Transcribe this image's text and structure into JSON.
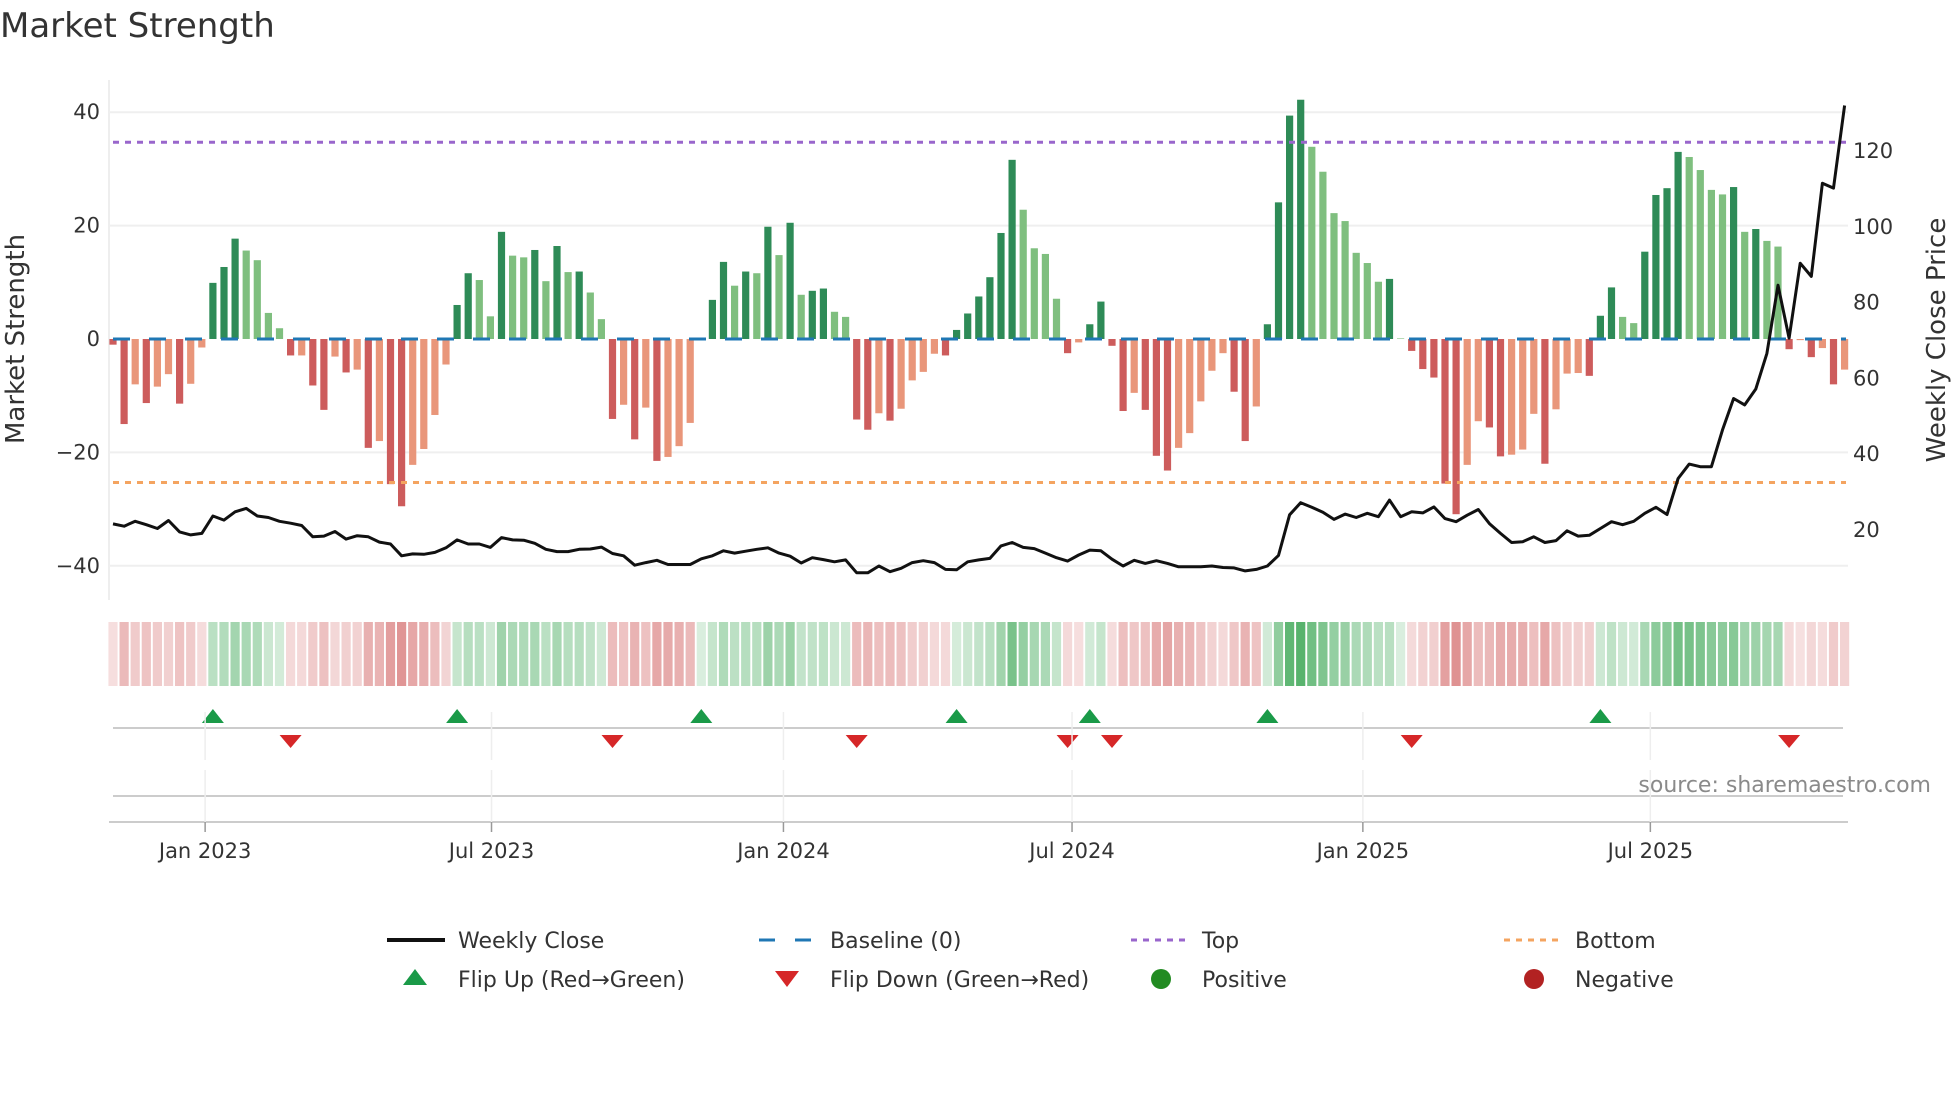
{
  "title": "Market Strength",
  "source": "source: sharemaestro.com",
  "colors": {
    "strong_green": "#2e8b57",
    "weak_green": "#7fbf7f",
    "strong_red": "#cd5c5c",
    "weak_red": "#e9967a",
    "baseline": "#1f77b4",
    "top": "#9966cc",
    "bottom": "#f4a460",
    "flip_up": "#1a9a48",
    "flip_down": "#d62728",
    "positive": "#228b22",
    "negative": "#b22222",
    "close": "#111111"
  },
  "legend": [
    {
      "key": "close",
      "label": "Weekly Close",
      "icon": "solid-line"
    },
    {
      "key": "baseline",
      "label": "Baseline (0)",
      "icon": "dashed-line"
    },
    {
      "key": "top",
      "label": "Top",
      "icon": "dotted-line"
    },
    {
      "key": "bottom",
      "label": "Bottom",
      "icon": "dotted-line"
    },
    {
      "key": "flip_up",
      "label": "Flip Up (Red→Green)",
      "icon": "triangle-up"
    },
    {
      "key": "flip_down",
      "label": "Flip Down (Green→Red)",
      "icon": "triangle-down"
    },
    {
      "key": "positive",
      "label": "Positive",
      "icon": "circle"
    },
    {
      "key": "negative",
      "label": "Negative",
      "icon": "circle"
    }
  ],
  "chart_data": {
    "type": "bar",
    "title": "Market Strength",
    "ylabel": "Market Strength",
    "y2label": "Weekly Close Price",
    "ylim": [
      -46,
      46
    ],
    "y2lim": [
      8,
      136
    ],
    "yticks": [
      40,
      20,
      0,
      -20,
      -40
    ],
    "y2ticks": [
      20,
      40,
      60,
      80,
      100,
      120
    ],
    "top_level": 34.7,
    "bottom_level": -25.3,
    "baseline_level": 0,
    "xticks": [
      {
        "label": "Jan 2023",
        "week": 9.3
      },
      {
        "label": "Jul 2023",
        "week": 35.1
      },
      {
        "label": "Jan 2024",
        "week": 61.4
      },
      {
        "label": "Jul 2024",
        "week": 87.4
      },
      {
        "label": "Jan 2025",
        "week": 113.6
      },
      {
        "label": "Jul 2025",
        "week": 139.5
      }
    ],
    "strength": [
      -1,
      -15,
      -8,
      -11.3,
      -8.4,
      -6.2,
      -11.4,
      -7.9,
      -1.5,
      9.9,
      12.7,
      17.7,
      15.6,
      13.9,
      4.6,
      1.9,
      -2.9,
      -2.9,
      -8.2,
      -12.5,
      -3.1,
      -5.9,
      -5.4,
      -19.2,
      -18,
      -25.6,
      -29.5,
      -22.2,
      -19.4,
      -13.4,
      -4.5,
      6,
      11.6,
      10.4,
      4,
      18.9,
      14.7,
      14.4,
      15.7,
      10.2,
      16.4,
      11.8,
      11.9,
      8.2,
      3.5,
      -14.1,
      -11.6,
      -17.7,
      -12.1,
      -21.5,
      -20.8,
      -18.9,
      -14.8,
      0.2,
      6.9,
      13.6,
      9.4,
      11.9,
      11.6,
      19.8,
      14.8,
      20.5,
      7.8,
      8.5,
      8.9,
      4.8,
      3.9,
      -14.2,
      -16,
      -13.1,
      -14.4,
      -12.3,
      -7.3,
      -5.8,
      -2.6,
      -2.9,
      1.6,
      4.5,
      7.5,
      10.9,
      18.7,
      31.6,
      22.8,
      16,
      15,
      7.1,
      -2.5,
      -0.6,
      2.6,
      6.6,
      -1.2,
      -12.7,
      -9.5,
      -12.5,
      -20.6,
      -23.2,
      -19.2,
      -16.6,
      -11,
      -5.6,
      -2.5,
      -9.3,
      -18,
      -11.9,
      2.6,
      24.1,
      39.4,
      42.2,
      33.9,
      29.5,
      22.2,
      20.8,
      15.2,
      13.4,
      10.1,
      10.6,
      0.1,
      -2.1,
      -5.3,
      -6.8,
      -25.5,
      -30.9,
      -22.2,
      -14.5,
      -15.6,
      -20.7,
      -20.4,
      -19.5,
      -13.2,
      -22,
      -12.4,
      -6.1,
      -6,
      -6.5,
      4.1,
      9.1,
      3.9,
      2.8,
      15.4,
      25.4,
      26.6,
      33,
      32.1,
      29.8,
      26.3,
      25.5,
      26.8,
      18.9,
      19.4,
      17.3,
      16.3,
      -1.8,
      -0.2,
      -3.2,
      -1.6,
      -8,
      -5.4
    ],
    "weekly_close": [
      21.6,
      21.0,
      22.3,
      21.4,
      20.4,
      22.5,
      19.5,
      18.7,
      19.1,
      23.7,
      22.6,
      24.8,
      25.7,
      23.7,
      23.3,
      22.3,
      21.8,
      21.2,
      18.2,
      18.4,
      19.6,
      17.6,
      18.5,
      18.2,
      16.8,
      16.3,
      13.2,
      13.7,
      13.6,
      14.1,
      15.3,
      17.4,
      16.3,
      16.3,
      15.4,
      18.0,
      17.4,
      17.3,
      16.5,
      14.9,
      14.3,
      14.3,
      14.9,
      15.0,
      15.5,
      13.8,
      13.2,
      10.7,
      11.4,
      12.0,
      10.9,
      10.9,
      10.9,
      12.4,
      13.2,
      14.5,
      13.9,
      14.4,
      14.9,
      15.3,
      13.9,
      13.1,
      11.3,
      12.7,
      12.2,
      11.6,
      12.1,
      8.7,
      8.7,
      10.5,
      9.0,
      9.9,
      11.4,
      11.9,
      11.4,
      9.6,
      9.5,
      11.6,
      12.1,
      12.5,
      15.8,
      16.7,
      15.4,
      15.1,
      13.9,
      12.7,
      11.8,
      13.4,
      14.7,
      14.5,
      12.3,
      10.5,
      12.0,
      11.2,
      11.9,
      11.2,
      10.3,
      10.3,
      10.3,
      10.5,
      10.1,
      10.0,
      9.2,
      9.6,
      10.5,
      13.3,
      24.0,
      27.2,
      26.0,
      24.7,
      22.8,
      24.2,
      23.3,
      24.4,
      23.5,
      27.9,
      23.5,
      24.8,
      24.5,
      26.1,
      23.0,
      22.2,
      23.9,
      25.4,
      21.7,
      19.1,
      16.7,
      16.9,
      18.2,
      16.7,
      17.2,
      19.8,
      18.4,
      18.6,
      20.4,
      22.2,
      21.4,
      22.3,
      24.4,
      26.0,
      24.1,
      33.6,
      37.4,
      36.7,
      36.7,
      46.4,
      54.7,
      53.0,
      57.2,
      66.6,
      84.6,
      70.6,
      90.4,
      86.9,
      111.5,
      110.2,
      132.0
    ],
    "legend_position": "bottom",
    "grid": true
  }
}
